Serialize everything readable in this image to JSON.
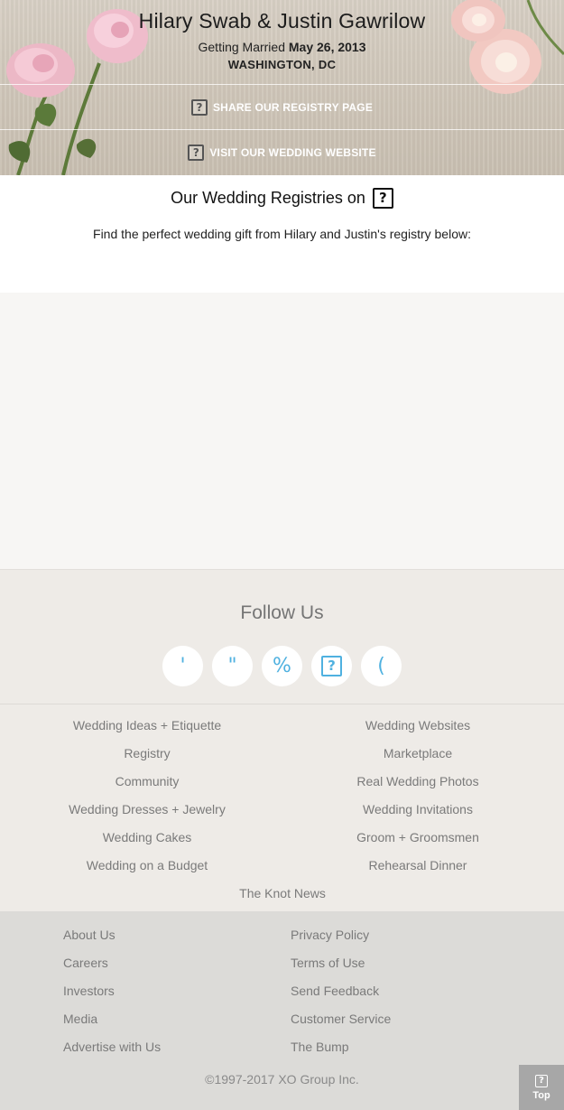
{
  "hero": {
    "couple_names": "Hilary Swab & Justin Gawrilow",
    "getting_married_label": "Getting Married",
    "wedding_date": "May 26, 2013",
    "location": "WASHINGTON, DC",
    "share_registry_label": "SHARE OUR REGISTRY PAGE",
    "visit_website_label": "VISIT OUR WEDDING WEBSITE",
    "icon_glyph": "?"
  },
  "registries": {
    "heading": "Our Wedding Registries on",
    "icon_glyph": "?",
    "description": "Find the perfect wedding gift from Hilary and Justin's registry below:"
  },
  "follow": {
    "title": "Follow Us",
    "social": [
      {
        "name": "facebook-icon",
        "glyph": "'"
      },
      {
        "name": "twitter-icon",
        "glyph": "\""
      },
      {
        "name": "pinterest-icon",
        "glyph": "%"
      },
      {
        "name": "instagram-icon",
        "glyph": "?"
      },
      {
        "name": "youtube-icon",
        "glyph": "("
      }
    ]
  },
  "site_links": {
    "left": [
      "Wedding Ideas + Etiquette",
      "Registry",
      "Community",
      "Wedding Dresses + Jewelry",
      "Wedding Cakes",
      "Wedding on a Budget"
    ],
    "right": [
      "Wedding Websites",
      "Marketplace",
      "Real Wedding Photos",
      "Wedding Invitations",
      "Groom + Groomsmen",
      "Rehearsal Dinner"
    ],
    "center": "The Knot News"
  },
  "footer": {
    "left": [
      "About Us",
      "Careers",
      "Investors",
      "Media",
      "Advertise with Us"
    ],
    "right": [
      "Privacy Policy",
      "Terms of Use",
      "Send Feedback",
      "Customer Service",
      "The Bump"
    ],
    "copyright": "©1997-2017 XO Group Inc.",
    "top_label": "Top",
    "top_icon_glyph": "?"
  },
  "colors": {
    "social_accent": "#4fb1e0",
    "hero_bg": "#d3cabd",
    "footer_bg": "#dcdbd8",
    "links_bg": "#eeebe7"
  }
}
